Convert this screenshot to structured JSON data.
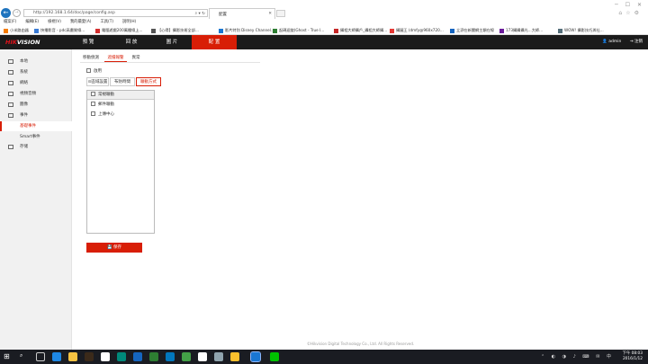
{
  "browser": {
    "url": "http://192.168.1.64/doc/page/config.asp",
    "tab_title": "配置",
    "menu": [
      "檔案(F)",
      "編輯(E)",
      "檢視(V)",
      "我的最愛(A)",
      "工具(T)",
      "說明(H)"
    ],
    "favorites": [
      {
        "label": "小米路由器",
        "color": "#f57c00"
      },
      {
        "label": "快播影音 - pdc高畫質線...",
        "color": "#3a7bd5"
      },
      {
        "label": "電腦遊戲200萬種線上...",
        "color": "#d32f2f"
      },
      {
        "label": "【心得】攝影技術全部...",
        "color": "#555555"
      },
      {
        "label": "影片特別 Disney Channel...",
        "color": "#1976d2"
      },
      {
        "label": "起碼迴旋(Ghost - True I...",
        "color": "#2e7d32"
      },
      {
        "label": "攝相大師攝戶_攝相大師攝...",
        "color": "#c62828"
      },
      {
        "label": "攝圖王 (dmfy@960x720...",
        "color": "#e53935"
      },
      {
        "label": "立淚在新聞網主類在線",
        "color": "#1565c0"
      },
      {
        "label": "173攝攝攝光...大師...",
        "color": "#6a1b9a"
      },
      {
        "label": "WOW! 攝影技巧與社...",
        "color": "#546e7a"
      }
    ]
  },
  "app": {
    "logo_main": "HIK",
    "logo_rest": "VISION",
    "nav": [
      "預 覽",
      "回 放",
      "圖 片",
      "配 置"
    ],
    "active_nav": 3,
    "user": "admin",
    "logout": "注销"
  },
  "sidebar": {
    "items": [
      {
        "label": "本地",
        "icon": "monitor-icon",
        "sub": false,
        "active": false
      },
      {
        "label": "系統",
        "icon": "system-icon",
        "sub": false,
        "active": false
      },
      {
        "label": "網絡",
        "icon": "network-icon",
        "sub": false,
        "active": false
      },
      {
        "label": "視頻音頻",
        "icon": "video-icon",
        "sub": false,
        "active": false
      },
      {
        "label": "圖像",
        "icon": "image-icon",
        "sub": false,
        "active": false
      },
      {
        "label": "事件",
        "icon": "event-icon",
        "sub": false,
        "active": false
      },
      {
        "label": "基礎事件",
        "icon": "",
        "sub": true,
        "active": true
      },
      {
        "label": "Smart事件",
        "icon": "",
        "sub": true,
        "active": false
      },
      {
        "label": "存储",
        "icon": "storage-icon",
        "sub": false,
        "active": false
      }
    ]
  },
  "main": {
    "tabs": [
      "移動偵測",
      "遮擋報警",
      "異常"
    ],
    "active_tab": 1,
    "enable_label": "啟用",
    "inner_tabs": [
      "區域設置",
      "布防時間",
      "聯動方式"
    ],
    "active_inner_tab": 2,
    "link_header": "常規聯動",
    "link_items": [
      "郵件聯動",
      "上傳中心"
    ],
    "save_label": "保存",
    "footer": "©Hikvision Digital Technology Co., Ltd. All Rights Reserved."
  },
  "taskbar": {
    "time": "下午 08:03",
    "date": "2016/1/12"
  }
}
